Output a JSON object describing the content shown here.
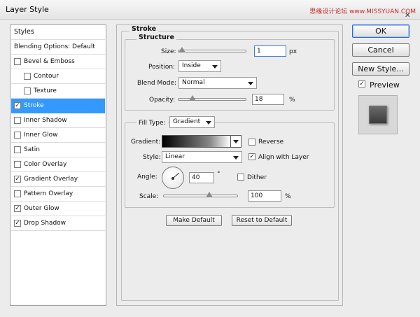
{
  "window": {
    "title": "Layer Style",
    "watermark": "思缘设计论坛 www.MISSYUAN.COM"
  },
  "style_list": {
    "header": "Styles",
    "blending_options": "Blending Options: Default",
    "items": [
      {
        "label": "Bevel & Emboss",
        "checked": false,
        "indent": false
      },
      {
        "label": "Contour",
        "checked": false,
        "indent": true
      },
      {
        "label": "Texture",
        "checked": false,
        "indent": true
      },
      {
        "label": "Stroke",
        "checked": true,
        "indent": false,
        "selected": true
      },
      {
        "label": "Inner Shadow",
        "checked": false,
        "indent": false
      },
      {
        "label": "Inner Glow",
        "checked": false,
        "indent": false
      },
      {
        "label": "Satin",
        "checked": false,
        "indent": false
      },
      {
        "label": "Color Overlay",
        "checked": false,
        "indent": false
      },
      {
        "label": "Gradient Overlay",
        "checked": true,
        "indent": false
      },
      {
        "label": "Pattern Overlay",
        "checked": false,
        "indent": false
      },
      {
        "label": "Outer Glow",
        "checked": true,
        "indent": false
      },
      {
        "label": "Drop Shadow",
        "checked": true,
        "indent": false
      }
    ]
  },
  "stroke": {
    "section_title": "Stroke",
    "structure_title": "Structure",
    "size_label": "Size:",
    "size_value": "1",
    "size_unit": "px",
    "position_label": "Position:",
    "position_value": "Inside",
    "blend_mode_label": "Blend Mode:",
    "blend_mode_value": "Normal",
    "opacity_label": "Opacity:",
    "opacity_value": "18",
    "opacity_unit": "%",
    "fill_type_label": "Fill Type:",
    "fill_type_value": "Gradient",
    "gradient_label": "Gradient:",
    "reverse_label": "Reverse",
    "reverse_checked": false,
    "style_label": "Style:",
    "style_value": "Linear",
    "align_label": "Align with Layer",
    "align_checked": true,
    "angle_label": "Angle:",
    "angle_value": "40",
    "angle_unit": "°",
    "dither_label": "Dither",
    "dither_checked": false,
    "scale_label": "Scale:",
    "scale_value": "100",
    "scale_unit": "%",
    "make_default": "Make Default",
    "reset_default": "Reset to Default"
  },
  "buttons": {
    "ok": "OK",
    "cancel": "Cancel",
    "new_style": "New Style..."
  },
  "preview": {
    "label": "Preview",
    "checked": true
  },
  "colors": {
    "selection": "#3399ff",
    "dialog_bg": "#ececec",
    "ok_border": "#2a6ad6"
  },
  "sliders": {
    "size_fraction": 0.01,
    "opacity_fraction": 0.18,
    "scale_fraction": 0.5
  }
}
